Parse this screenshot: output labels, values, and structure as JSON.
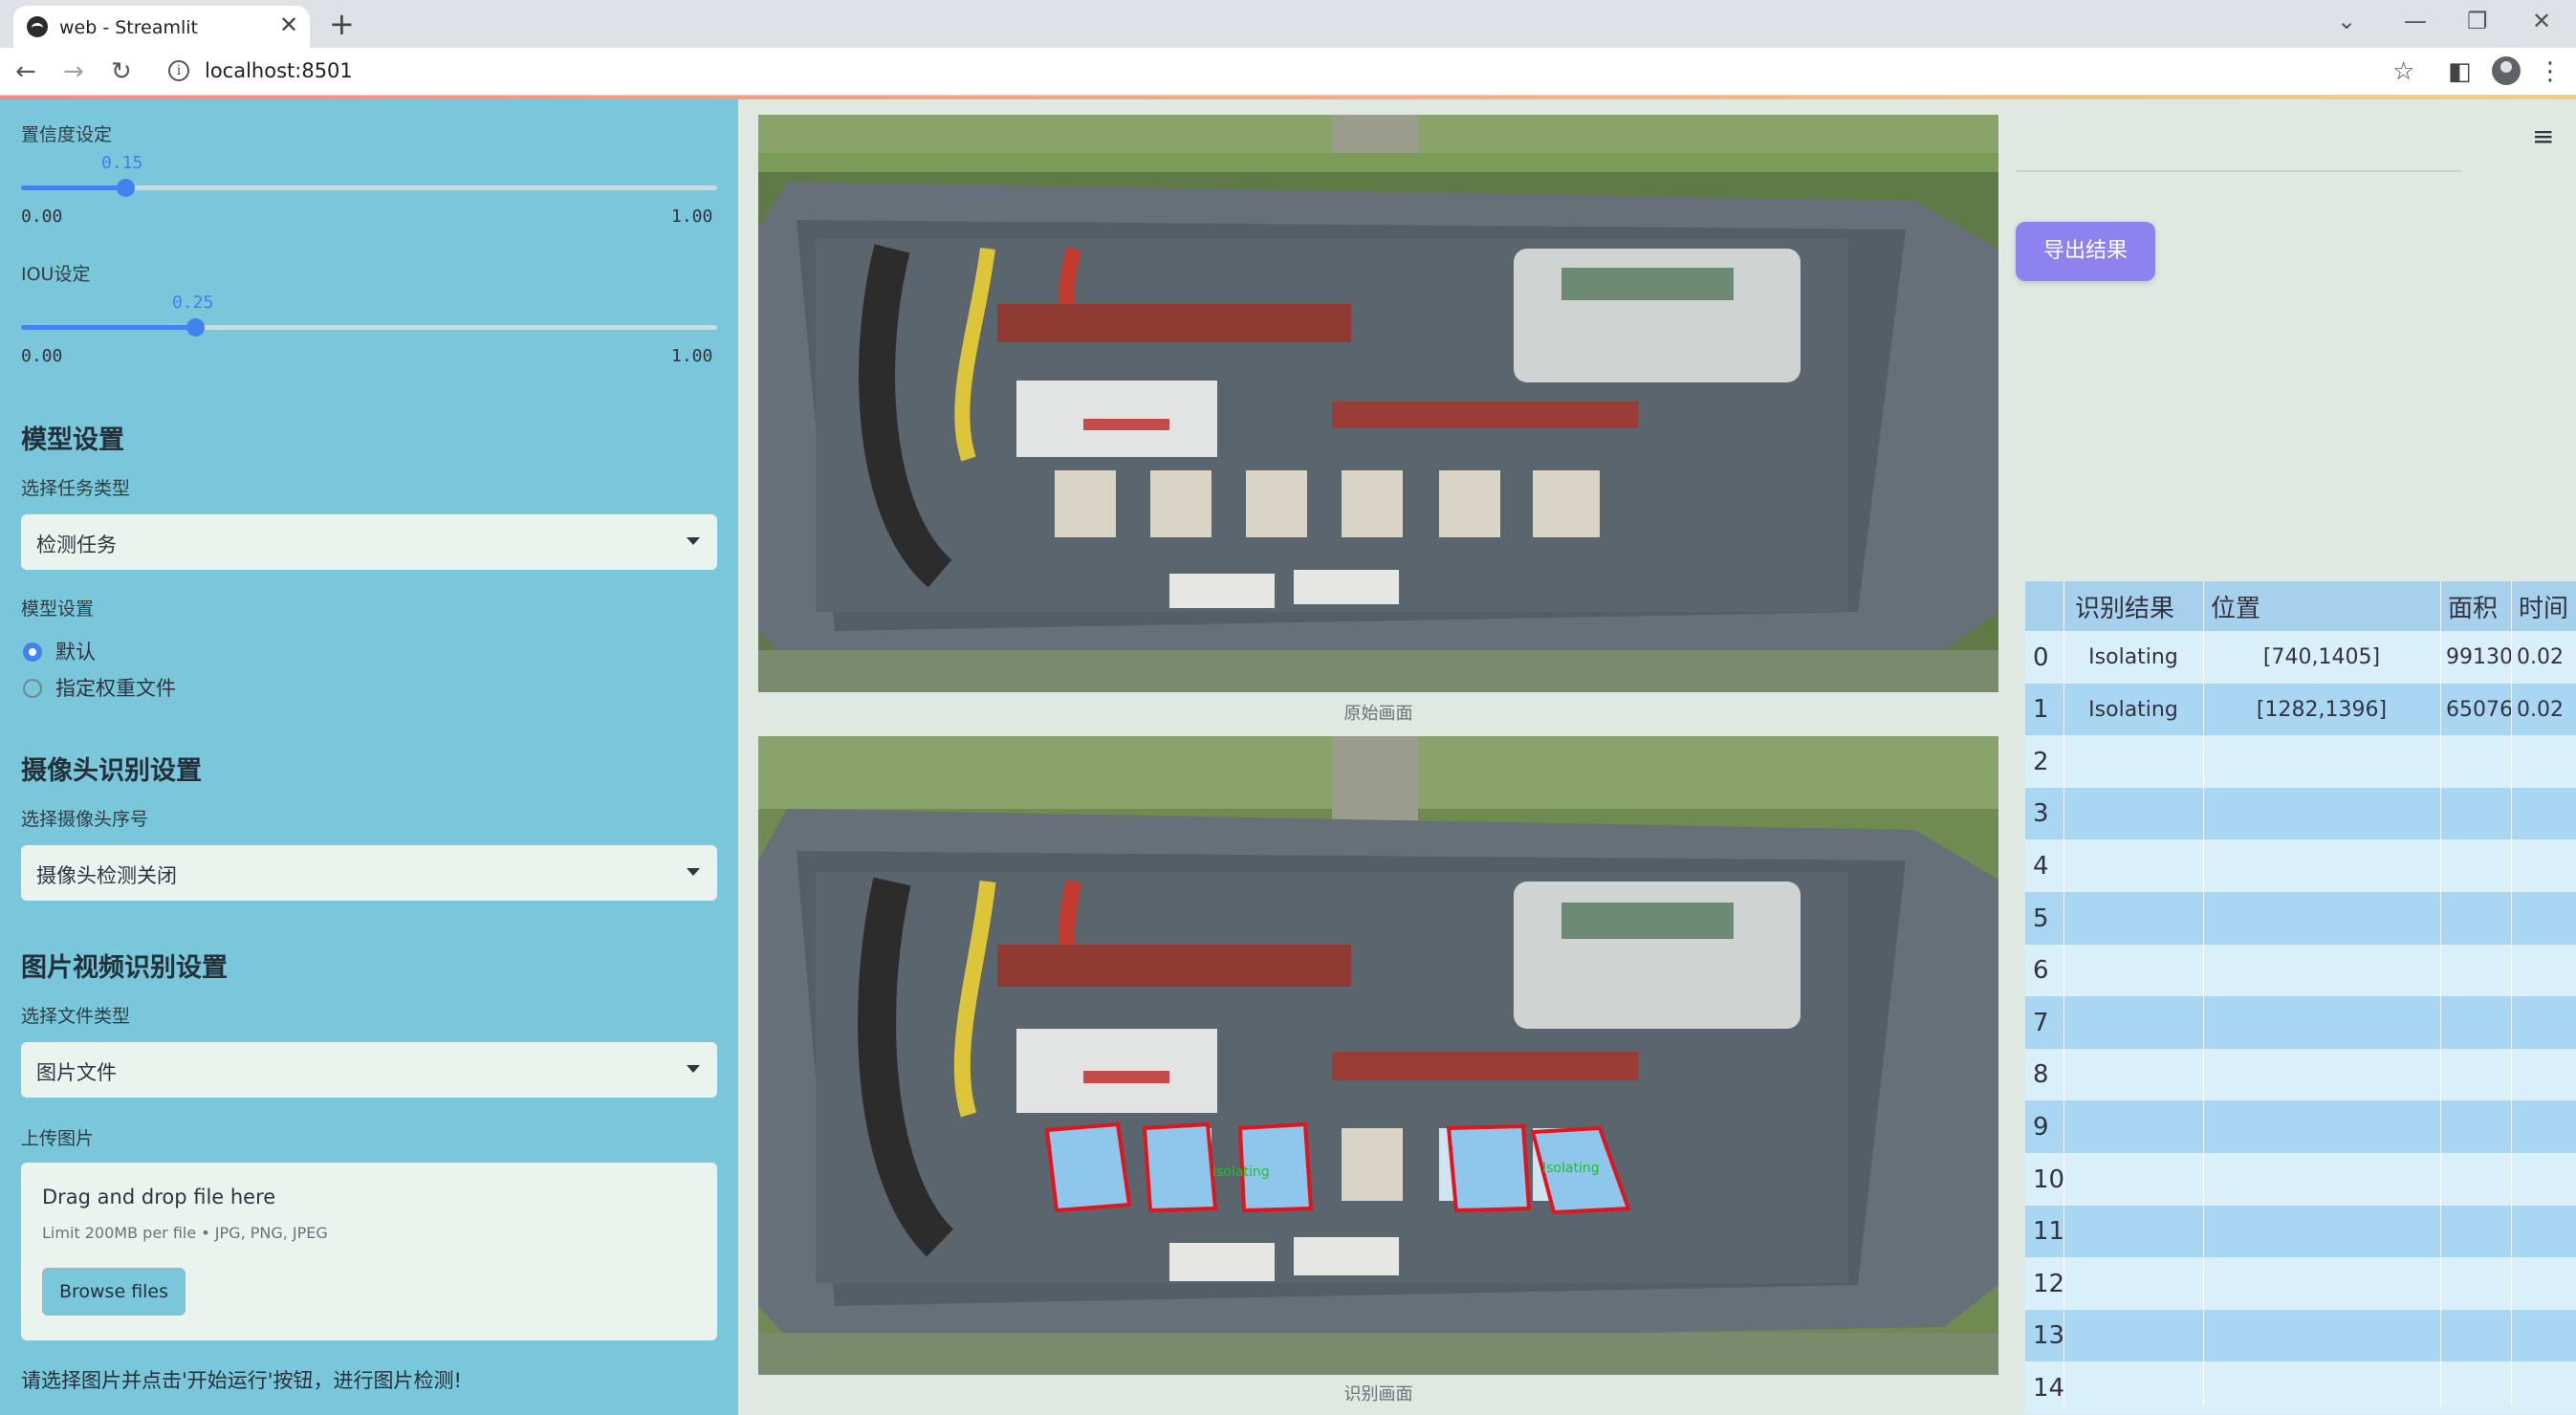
{
  "browser": {
    "tab_title": "web - Streamlit",
    "url": "localhost:8501"
  },
  "sidebar": {
    "confidence": {
      "label": "置信度设定",
      "value": "0.15",
      "min": "0.00",
      "max": "1.00",
      "fraction": 0.15
    },
    "iou": {
      "label": "IOU设定",
      "value": "0.25",
      "min": "0.00",
      "max": "1.00",
      "fraction": 0.25
    },
    "model_heading": "模型设置",
    "task_label": "选择任务类型",
    "task_value": "检测任务",
    "model_label": "模型设置",
    "model_options": [
      {
        "label": "默认",
        "selected": true
      },
      {
        "label": "指定权重文件",
        "selected": false
      }
    ],
    "camera_heading": "摄像头识别设置",
    "camera_label": "选择摄像头序号",
    "camera_value": "摄像头检测关闭",
    "file_heading": "图片视频识别设置",
    "file_type_label": "选择文件类型",
    "file_type_value": "图片文件",
    "upload_label": "上传图片",
    "upload_title": "Drag and drop file here",
    "upload_limit": "Limit 200MB per file • JPG, PNG, JPEG",
    "browse_label": "Browse files",
    "hint": "请选择图片并点击'开始运行'按钮，进行图片检测!"
  },
  "main": {
    "original_caption": "原始画面",
    "result_caption": "识别画面",
    "detection_label": "Isolating"
  },
  "right": {
    "export_label": "导出结果",
    "table": {
      "headers": [
        "识别结果",
        "位置",
        "面积",
        "时间"
      ],
      "rows": [
        {
          "index": "0",
          "result": "Isolating",
          "position": "[740,1405]",
          "area": "99130",
          "time": "0.02"
        },
        {
          "index": "1",
          "result": "Isolating",
          "position": "[1282,1396]",
          "area": "65076",
          "time": "0.02"
        },
        {
          "index": "2",
          "result": "",
          "position": "",
          "area": "",
          "time": ""
        },
        {
          "index": "3",
          "result": "",
          "position": "",
          "area": "",
          "time": ""
        },
        {
          "index": "4",
          "result": "",
          "position": "",
          "area": "",
          "time": ""
        },
        {
          "index": "5",
          "result": "",
          "position": "",
          "area": "",
          "time": ""
        },
        {
          "index": "6",
          "result": "",
          "position": "",
          "area": "",
          "time": ""
        },
        {
          "index": "7",
          "result": "",
          "position": "",
          "area": "",
          "time": ""
        },
        {
          "index": "8",
          "result": "",
          "position": "",
          "area": "",
          "time": ""
        },
        {
          "index": "9",
          "result": "",
          "position": "",
          "area": "",
          "time": ""
        },
        {
          "index": "10",
          "result": "",
          "position": "",
          "area": "",
          "time": ""
        },
        {
          "index": "11",
          "result": "",
          "position": "",
          "area": "",
          "time": ""
        },
        {
          "index": "12",
          "result": "",
          "position": "",
          "area": "",
          "time": ""
        },
        {
          "index": "13",
          "result": "",
          "position": "",
          "area": "",
          "time": ""
        },
        {
          "index": "14",
          "result": "",
          "position": "",
          "area": "",
          "time": ""
        }
      ]
    }
  },
  "colors": {
    "sidebar_bg": "#7ac6da",
    "accent_blue": "#3f82f0",
    "export_button": "#8d82ef",
    "detection_box": "#e2141e",
    "detection_text": "#22c02a"
  }
}
